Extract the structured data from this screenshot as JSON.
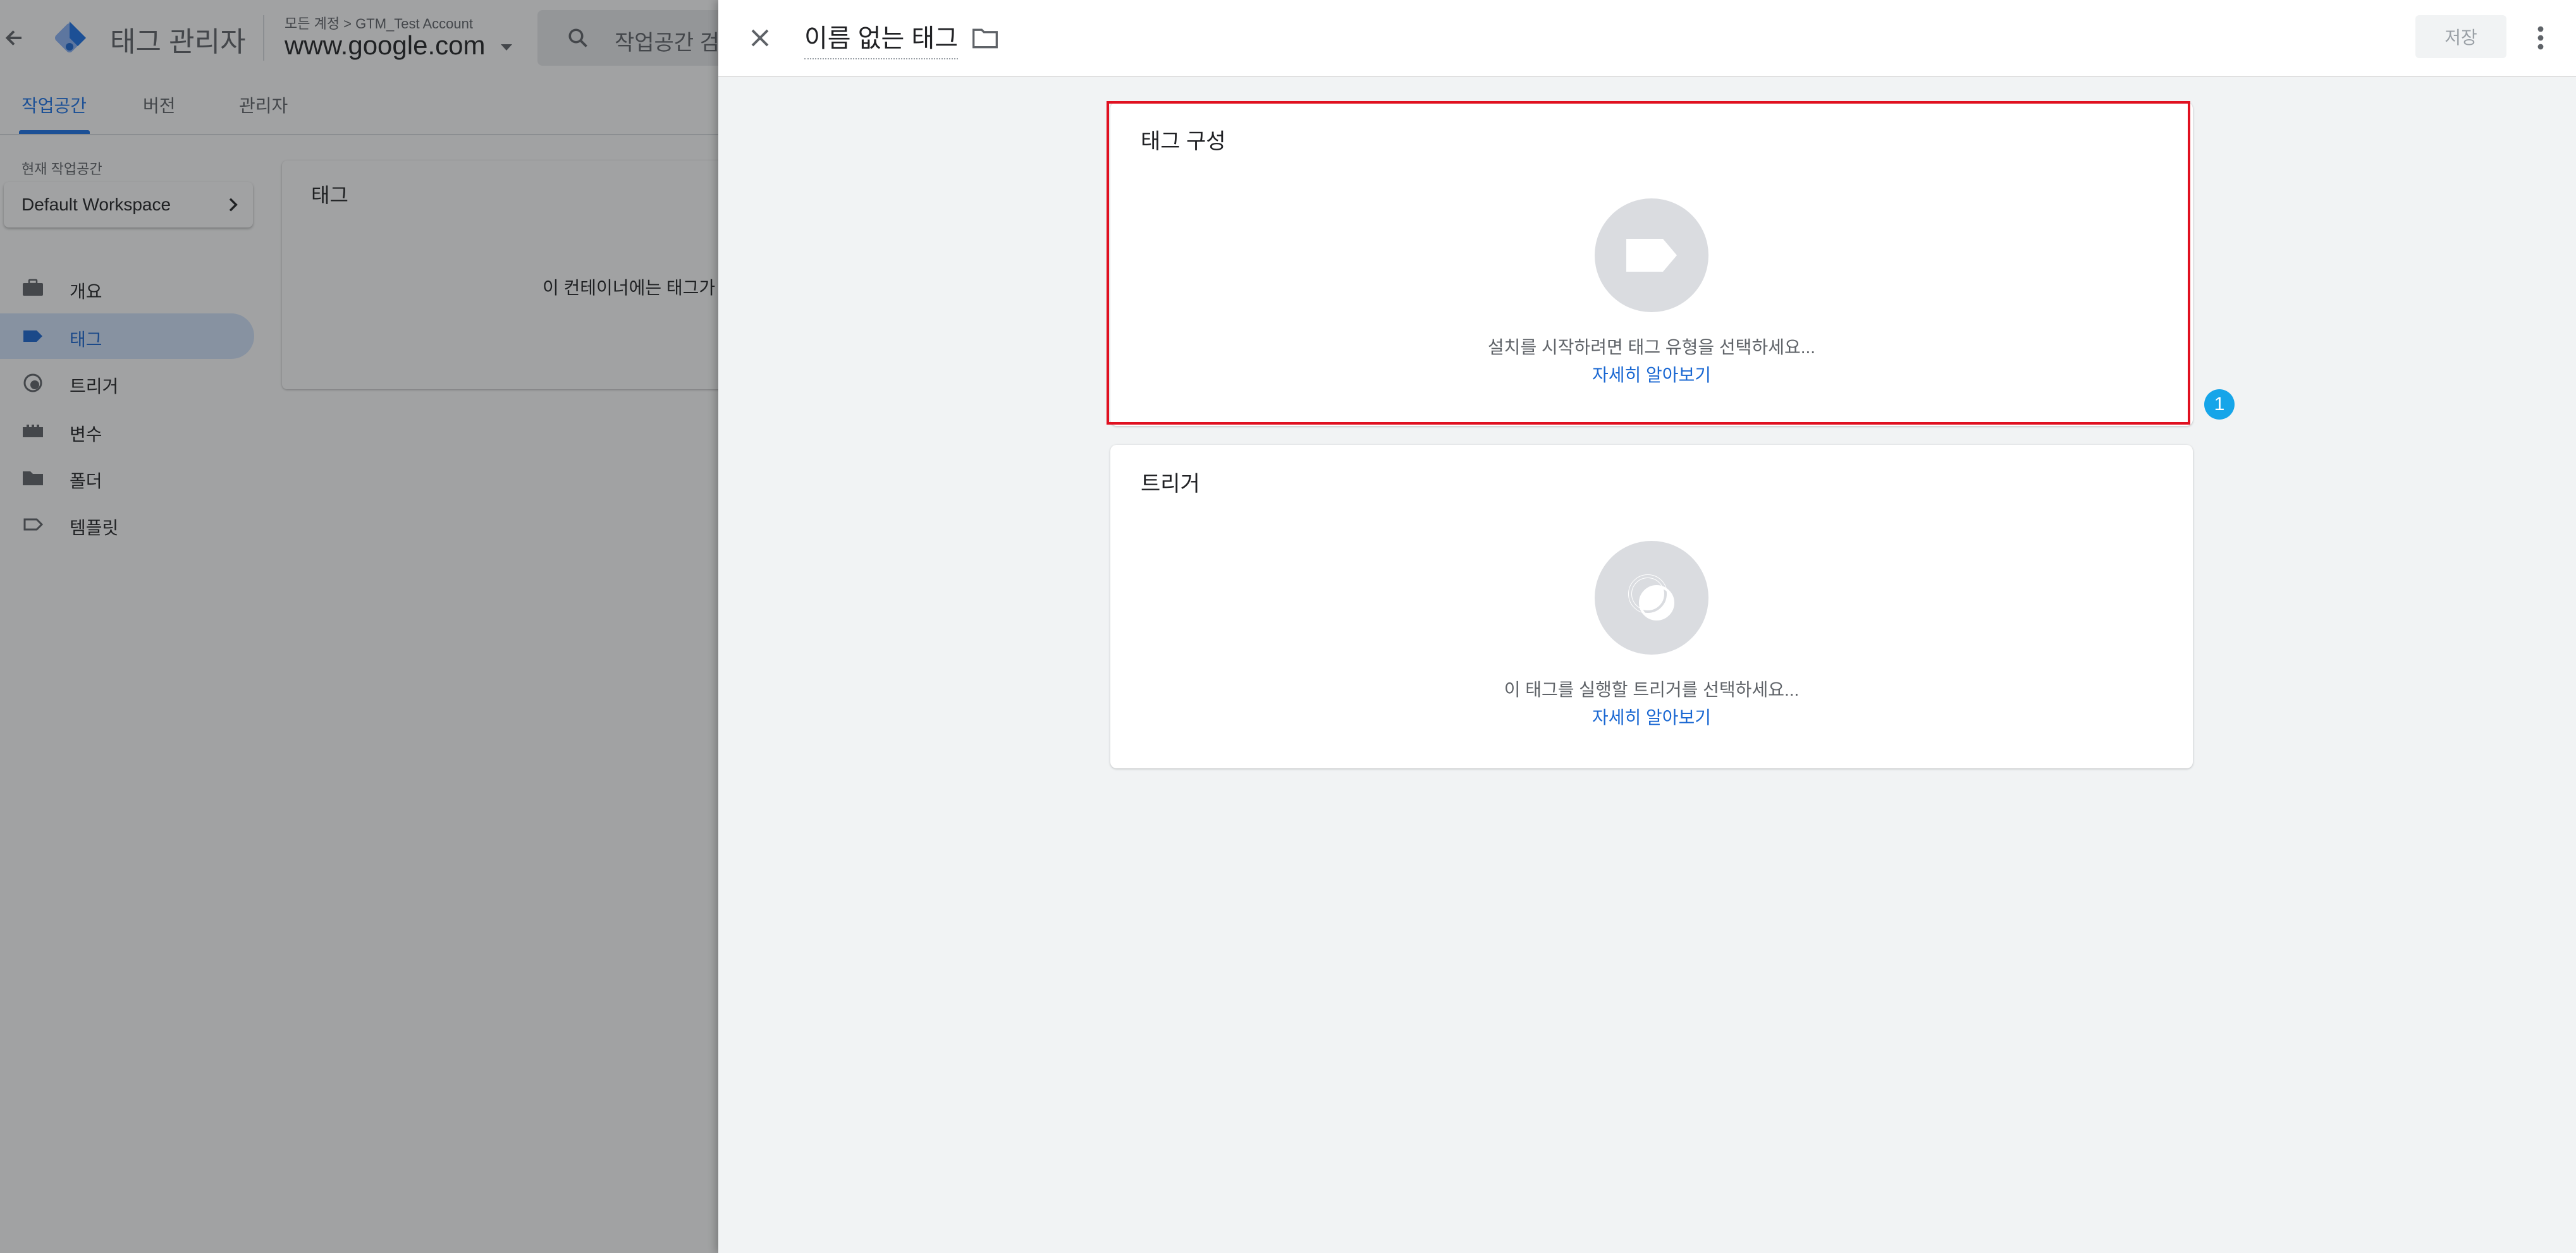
{
  "app": {
    "product_name": "태그 관리자",
    "account_path": "모든 계정 > GTM_Test Account",
    "container_name": "www.google.com",
    "search_placeholder": "작업공간 검색"
  },
  "tabs": [
    {
      "label": "작업공간",
      "active": true
    },
    {
      "label": "버전",
      "active": false
    },
    {
      "label": "관리자",
      "active": false
    }
  ],
  "sidebar": {
    "workspace_label": "현재 작업공간",
    "workspace_name": "Default Workspace",
    "items": [
      {
        "label": "개요",
        "icon": "briefcase-icon"
      },
      {
        "label": "태그",
        "icon": "tag-icon",
        "active": true
      },
      {
        "label": "트리거",
        "icon": "trigger-icon"
      },
      {
        "label": "변수",
        "icon": "variables-icon"
      },
      {
        "label": "폴더",
        "icon": "folder-icon"
      },
      {
        "label": "템플릿",
        "icon": "template-icon"
      }
    ]
  },
  "main": {
    "card_title": "태그",
    "empty_text": "이 컨테이너에는 태그가"
  },
  "sheet": {
    "tag_name": "이름 없는 태그",
    "save_label": "저장",
    "tag_config": {
      "title": "태그 구성",
      "hint": "설치를 시작하려면 태그 유형을 선택하세요...",
      "link": "자세히 알아보기"
    },
    "triggering": {
      "title": "트리거",
      "hint": "이 태그를 실행할 트리거를 선택하세요...",
      "link": "자세히 알아보기"
    },
    "callout_number": "1"
  },
  "colors": {
    "accent": "#1a73e8",
    "highlight": "#e01020",
    "callout": "#16a5e9",
    "icon_circle": "#dadce0"
  }
}
